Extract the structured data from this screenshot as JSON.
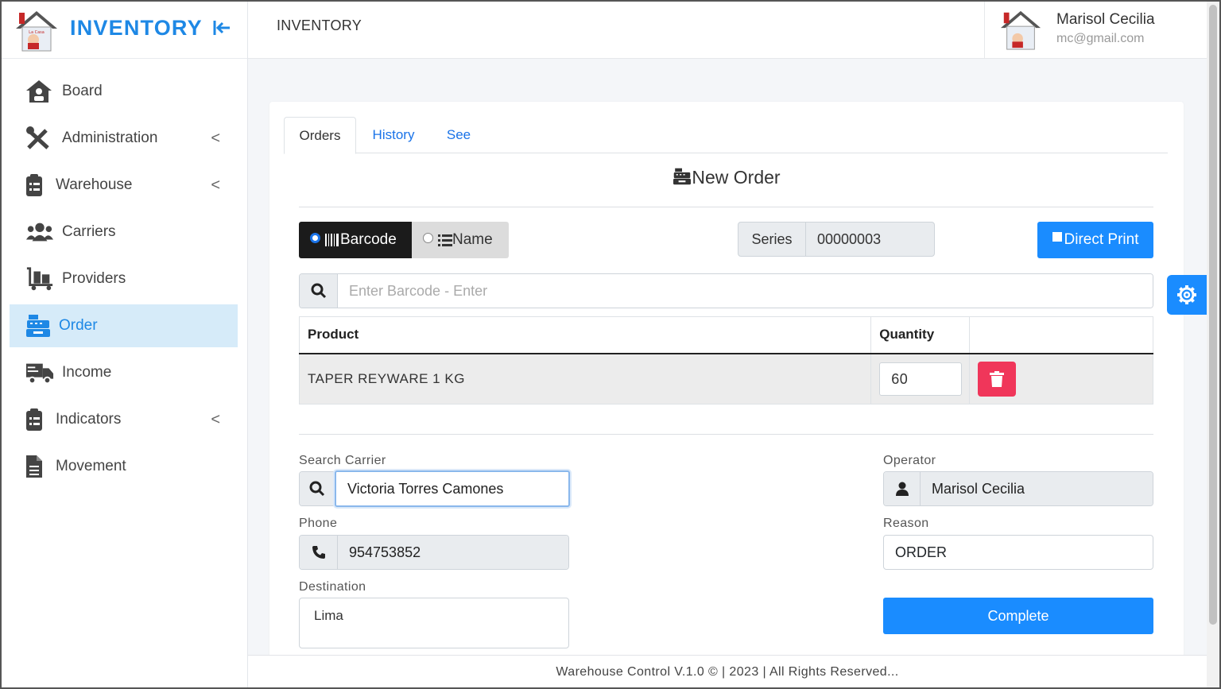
{
  "brand": {
    "title": "INVENTORY"
  },
  "header": {
    "page_title": "INVENTORY"
  },
  "user": {
    "name": "Marisol Cecilia",
    "email": "mc@gmail.com"
  },
  "sidebar": {
    "items": [
      {
        "label": "Board",
        "icon": "home-icon"
      },
      {
        "label": "Administration",
        "icon": "tools-icon",
        "chevron": "<"
      },
      {
        "label": "Warehouse",
        "icon": "clipboard-icon",
        "chevron": "<"
      },
      {
        "label": "Carriers",
        "icon": "users-icon"
      },
      {
        "label": "Providers",
        "icon": "dolly-icon"
      },
      {
        "label": "Order",
        "icon": "cash-register-icon",
        "active": true
      },
      {
        "label": "Income",
        "icon": "truck-icon"
      },
      {
        "label": "Indicators",
        "icon": "clipboard-icon",
        "chevron": "<"
      },
      {
        "label": "Movement",
        "icon": "file-icon"
      }
    ]
  },
  "tabs": [
    "Orders",
    "History",
    "See"
  ],
  "form": {
    "title": "New Order",
    "mode_barcode": "Barcode",
    "mode_name": "Name",
    "series_label": "Series",
    "series_value": "00000003",
    "direct_print": "Direct Print",
    "barcode_placeholder": "Enter Barcode - Enter",
    "table": {
      "headers": [
        "Product",
        "Quantity",
        ""
      ],
      "rows": [
        {
          "product": "TAPER REYWARE 1 KG",
          "quantity": "60"
        }
      ]
    },
    "search_carrier_label": "Search Carrier",
    "search_carrier_value": "Victoria Torres Camones",
    "phone_label": "Phone",
    "phone_value": "954753852",
    "destination_label": "Destination",
    "destination_value": "Lima",
    "operator_label": "Operator",
    "operator_value": "Marisol Cecilia",
    "reason_label": "Reason",
    "reason_value": "ORDER",
    "complete_label": "Complete"
  },
  "footer": {
    "text": "Warehouse Control V.1.0 © | 2023 | All Rights Reserved..."
  },
  "colors": {
    "accent": "#1a8cff",
    "brand": "#1e88e5",
    "active_bg": "#d6ebf9",
    "danger": "#f0365a"
  }
}
